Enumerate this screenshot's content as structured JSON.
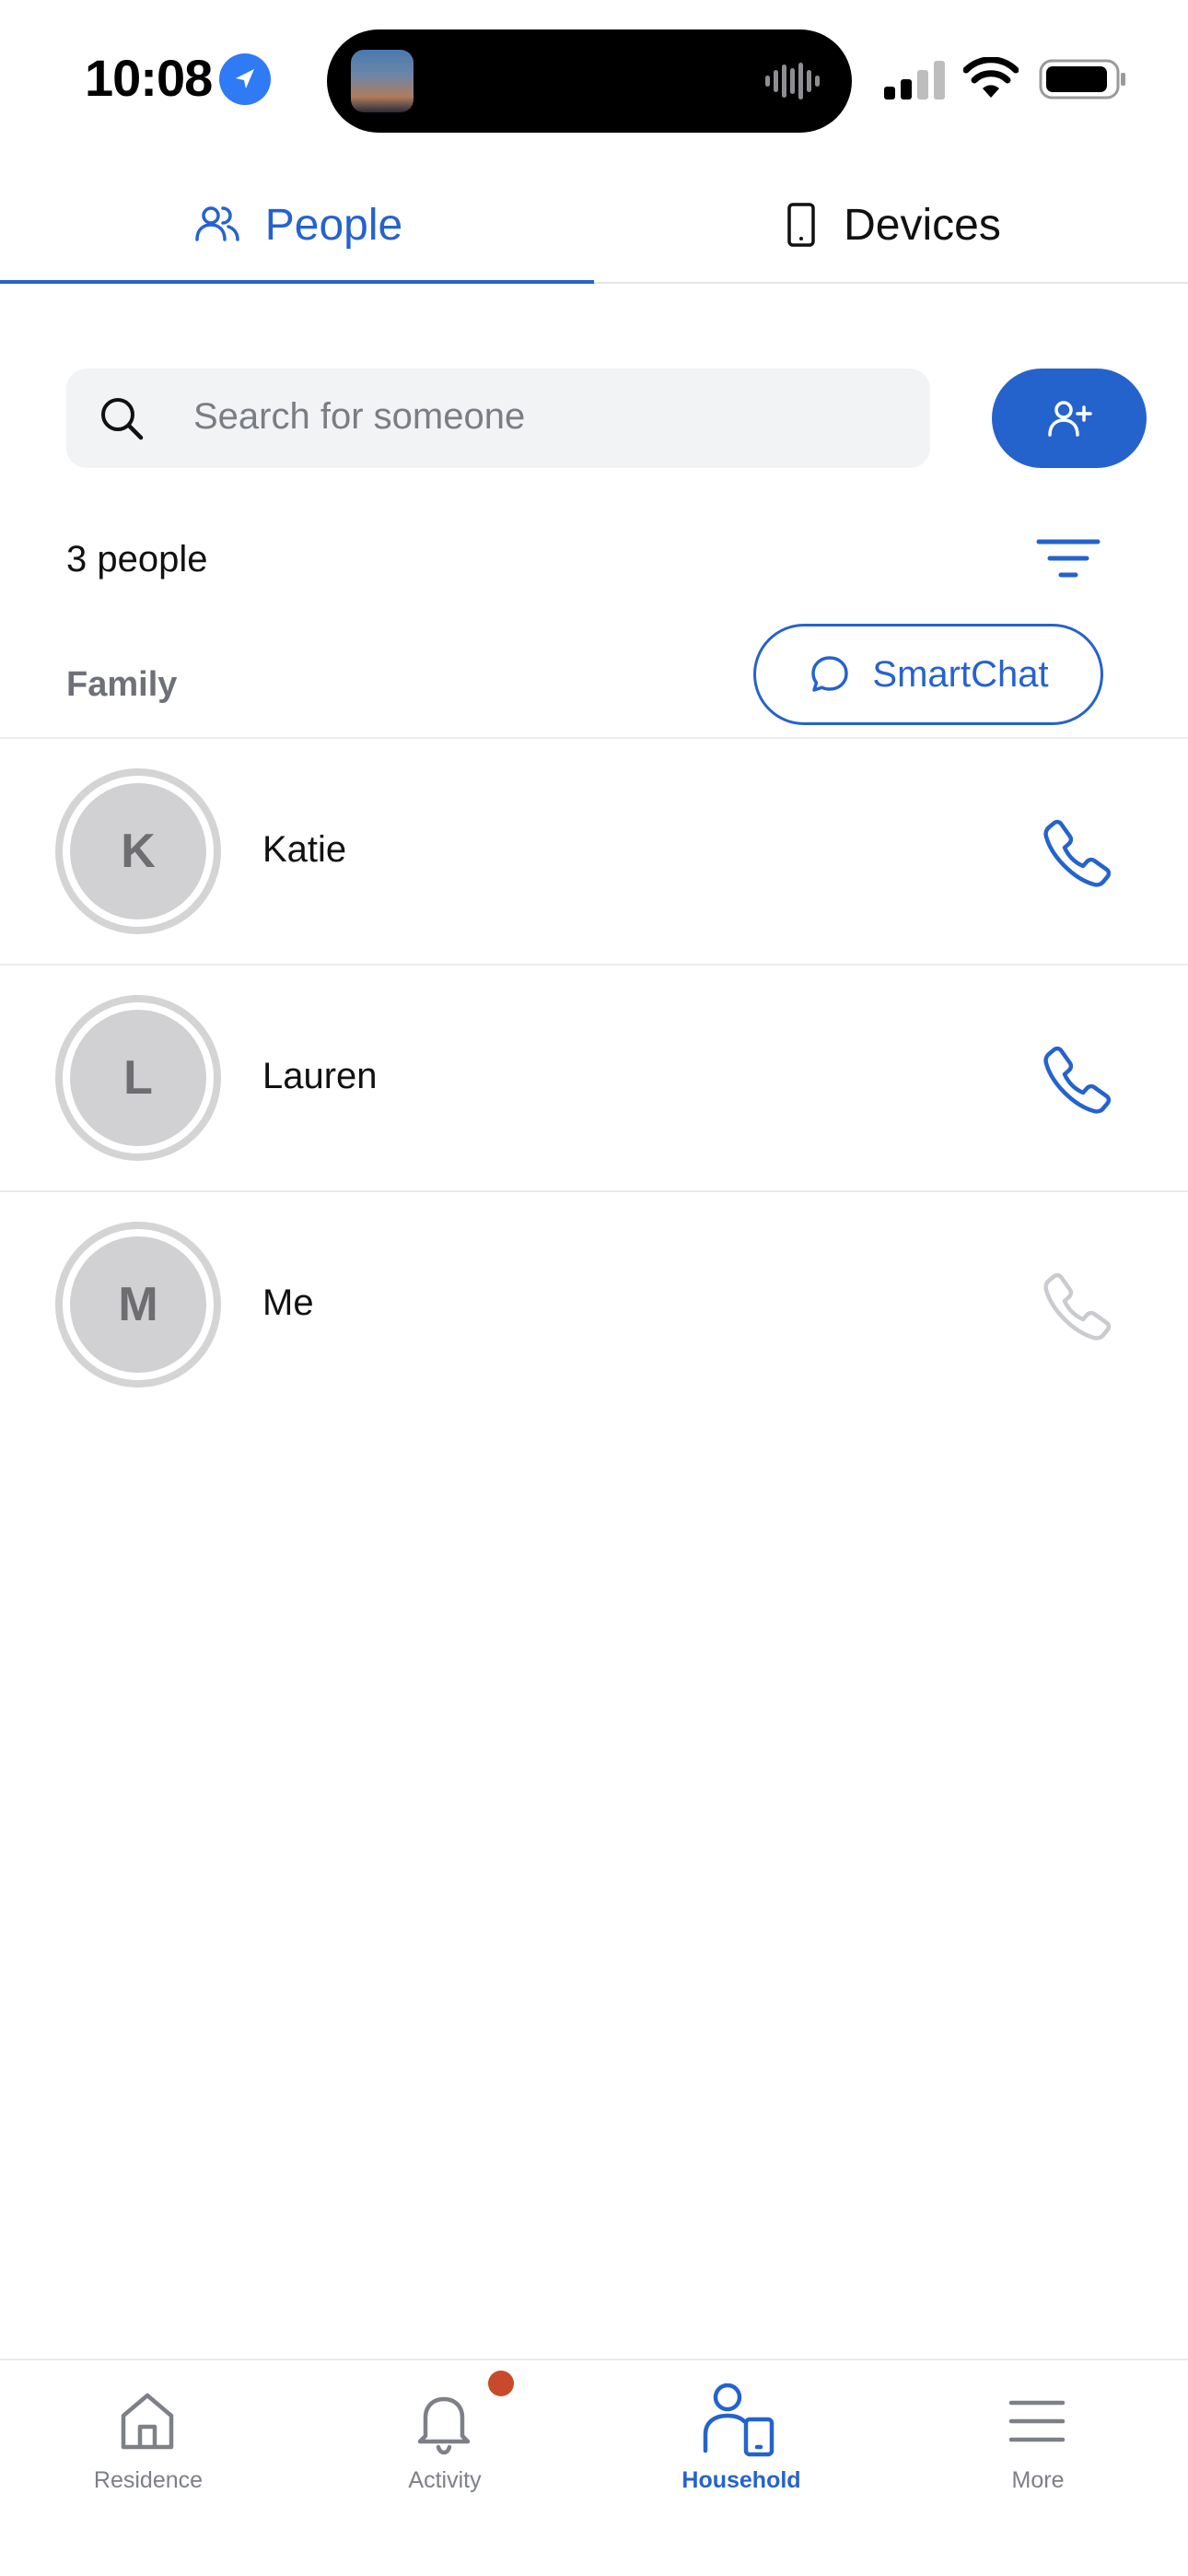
{
  "status_bar": {
    "time": "10:08"
  },
  "tabs": [
    {
      "label": "People",
      "icon": "people-icon",
      "selected": true
    },
    {
      "label": "Devices",
      "icon": "phone-device-icon",
      "selected": false
    }
  ],
  "search": {
    "placeholder": "Search for someone",
    "value": ""
  },
  "people_count": "3 people",
  "group": {
    "header": "Family",
    "smartchat_label": "SmartChat"
  },
  "people": [
    {
      "initial": "K",
      "name": "Katie",
      "call_enabled": true
    },
    {
      "initial": "L",
      "name": "Lauren",
      "call_enabled": true
    },
    {
      "initial": "M",
      "name": "Me",
      "call_enabled": false
    }
  ],
  "bottom_nav": [
    {
      "label": "Residence",
      "icon": "home-icon",
      "active": false
    },
    {
      "label": "Activity",
      "icon": "bell-icon",
      "active": false,
      "badge": true
    },
    {
      "label": "Household",
      "icon": "household-icon",
      "active": true
    },
    {
      "label": "More",
      "icon": "menu-icon",
      "active": false
    }
  ],
  "colors": {
    "accent": "#2563cc",
    "badge": "#c8492b",
    "muted_call": "#c9cbcf"
  }
}
